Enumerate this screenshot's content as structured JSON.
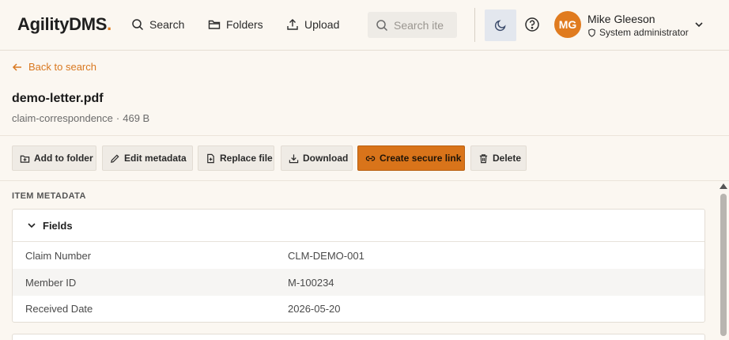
{
  "header": {
    "logo_text": "AgilityDMS",
    "logo_dot": ".",
    "nav": [
      {
        "label": "Search",
        "icon": "search-icon"
      },
      {
        "label": "Folders",
        "icon": "folder-icon"
      },
      {
        "label": "Upload",
        "icon": "upload-icon"
      }
    ],
    "search_placeholder": "Search ite",
    "user": {
      "initials": "MG",
      "name": "Mike Gleeson",
      "role": "System administrator"
    }
  },
  "back_link": "Back to search",
  "document": {
    "title": "demo-letter.pdf",
    "category": "claim-correspondence",
    "separator": "·",
    "size": "469 B"
  },
  "toolbar": {
    "add_to_folder": "Add to folder",
    "edit_metadata": "Edit metadata",
    "replace_file": "Replace file",
    "download": "Download",
    "create_secure_link": "Create secure link",
    "delete": "Delete"
  },
  "metadata": {
    "section_label": "ITEM METADATA",
    "card_title": "Fields",
    "rows": [
      {
        "key": "Claim Number",
        "value": "CLM-DEMO-001"
      },
      {
        "key": "Member ID",
        "value": "M-100234"
      },
      {
        "key": "Received Date",
        "value": "2026-05-20"
      }
    ]
  },
  "colors": {
    "accent": "#d9741a",
    "background": "#fbf7f1",
    "link": "#d9781f"
  }
}
